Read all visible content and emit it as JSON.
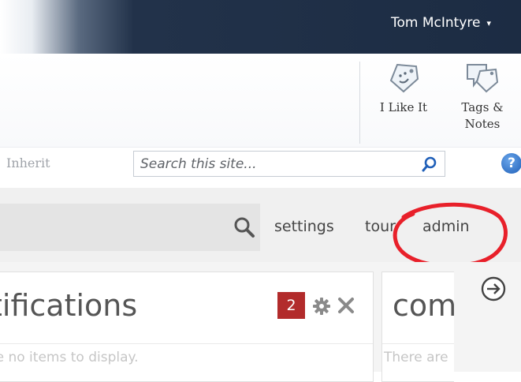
{
  "header": {
    "user_name": "Tom McIntyre",
    "caret": "▾"
  },
  "ribbon": {
    "like_label": "I Like It",
    "tags_label_line1": "Tags &",
    "tags_label_line2": "Notes"
  },
  "searchbar": {
    "inherit_text": "Inherit",
    "placeholder": "Search this site...",
    "help": "?"
  },
  "nav": {
    "settings": "settings",
    "tour": "tour",
    "admin": "admin",
    "highlight_color": "#e8202a"
  },
  "cards": {
    "notifications": {
      "title_visible": "tifications",
      "empty_text": "re no items to display.",
      "badge_count": "2"
    },
    "community": {
      "title_visible": "com",
      "empty_text": "There are"
    }
  },
  "colors": {
    "topbar": "#1c2c43",
    "badge": "#b22b2b",
    "search_accent": "#1f5fb8"
  }
}
